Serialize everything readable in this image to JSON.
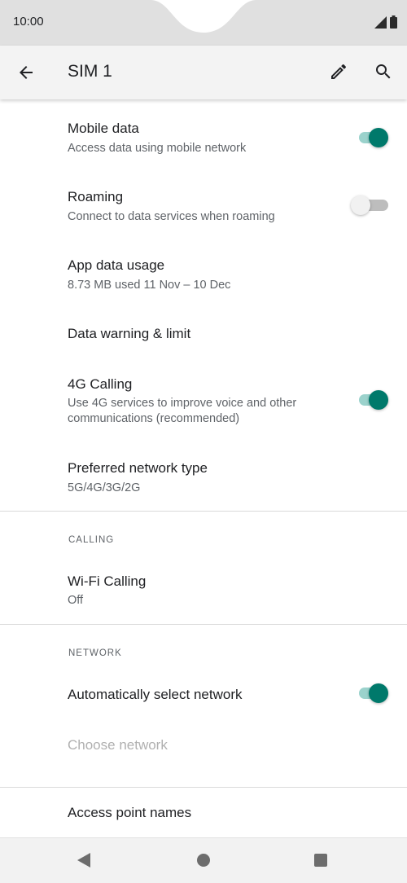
{
  "status_bar": {
    "time": "10:00"
  },
  "app_bar": {
    "title": "SIM 1"
  },
  "items": {
    "mobile_data": {
      "title": "Mobile data",
      "summary": "Access data using mobile network",
      "enabled": true
    },
    "roaming": {
      "title": "Roaming",
      "summary": "Connect to data services when roaming",
      "enabled": false
    },
    "app_data_usage": {
      "title": "App data usage",
      "summary": "8.73 MB used 11 Nov – 10 Dec"
    },
    "data_warning": {
      "title": "Data warning & limit"
    },
    "calling_4g": {
      "title": "4G Calling",
      "summary": "Use 4G services to improve voice and other communications (recommended)",
      "enabled": true
    },
    "preferred_network": {
      "title": "Preferred network type",
      "summary": "5G/4G/3G/2G"
    }
  },
  "sections": {
    "calling": {
      "header": "CALLING",
      "wifi_calling": {
        "title": "Wi-Fi Calling",
        "summary": "Off"
      }
    },
    "network": {
      "header": "NETWORK",
      "auto_select": {
        "title": "Automatically select network",
        "enabled": true
      },
      "choose_network": {
        "title": "Choose network"
      }
    }
  },
  "access_point": {
    "title": "Access point names"
  },
  "colors": {
    "accent": "#00796b",
    "accent_track": "#9bd2cc",
    "statusbar": "#e0e0e0",
    "appbar": "#f3f3f3"
  }
}
